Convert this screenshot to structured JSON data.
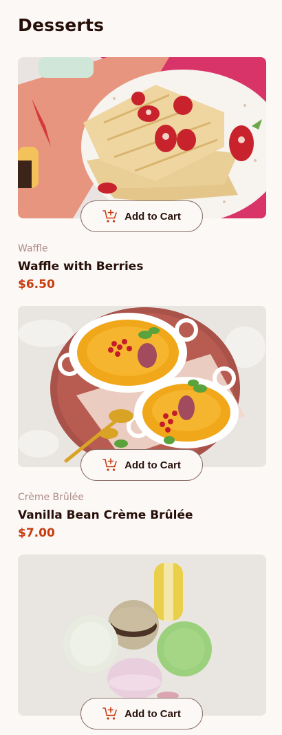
{
  "page": {
    "title": "Desserts"
  },
  "colors": {
    "accent": "#c73b0f",
    "text": "#260f08",
    "muted": "#ad8a85",
    "background": "#fcf8f6"
  },
  "products": [
    {
      "image": "waffle-photo",
      "category": "Waffle",
      "name": "Waffle with Berries",
      "price": "$6.50",
      "button_label": "Add to Cart",
      "button_icon": "add-to-cart-icon"
    },
    {
      "image": "creme-brulee-photo",
      "category": "Crème Brûlée",
      "name": "Vanilla Bean Crème Brûlée",
      "price": "$7.00",
      "button_label": "Add to Cart",
      "button_icon": "add-to-cart-icon"
    },
    {
      "image": "macaron-photo",
      "button_label": "Add to Cart",
      "button_icon": "add-to-cart-icon"
    }
  ]
}
